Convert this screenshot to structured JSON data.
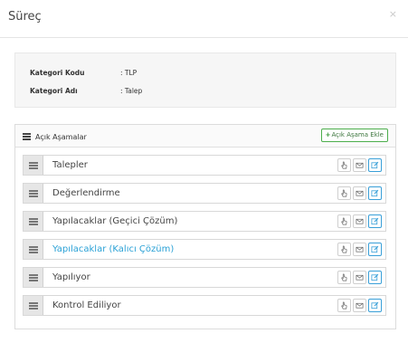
{
  "modal": {
    "title": "Süreç",
    "close": "×"
  },
  "info": {
    "code_label": "Kategori Kodu",
    "code_value": ": TLP",
    "name_label": "Kategori Adı",
    "name_value": ": Talep"
  },
  "panel": {
    "title": "Açık Aşamalar",
    "add_button": "Açık Aşama Ekle",
    "add_icon": "+"
  },
  "stages": [
    {
      "name": "Talepler",
      "active": false
    },
    {
      "name": "Değerlendirme",
      "active": false
    },
    {
      "name": "Yapılacaklar (Geçici Çözüm)",
      "active": false
    },
    {
      "name": "Yapılacaklar (Kalıcı Çözüm)",
      "active": true
    },
    {
      "name": "Yapılıyor",
      "active": false
    },
    {
      "name": "Kontrol Ediliyor",
      "active": false
    }
  ],
  "icons": {
    "handle": "drag-handle-icon",
    "hand": "hand-pointer-icon",
    "mail": "envelope-icon",
    "edit": "edit-icon"
  },
  "colors": {
    "accent": "#2aa1d6",
    "add_green": "#4cae4c",
    "handle_bg": "#e6e6e6"
  }
}
